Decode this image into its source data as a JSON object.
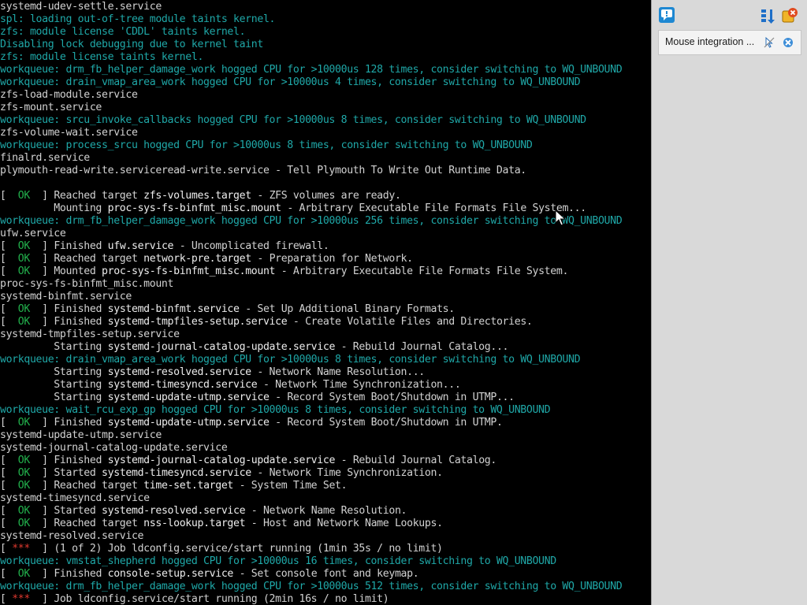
{
  "console": {
    "colors": {
      "default": "#c8c8c8",
      "unit": "#ededed",
      "kernel_message": "#1fa8a8",
      "ok_status": "#22b14c",
      "in_progress_status": "#e0392f",
      "background": "#000000"
    },
    "lines": [
      [
        {
          "t": "systemd-udev-settle.service",
          "c": "white"
        }
      ],
      [
        {
          "t": "spl: loading out-of-tree module taints kernel.",
          "c": "teal"
        }
      ],
      [
        {
          "t": "zfs: module license 'CDDL' taints kernel.",
          "c": "teal"
        }
      ],
      [
        {
          "t": "Disabling lock debugging due to kernel taint",
          "c": "teal"
        }
      ],
      [
        {
          "t": "zfs: module license taints kernel.",
          "c": "teal"
        }
      ],
      [
        {
          "t": "workqueue: drm_fb_helper_damage_work hogged CPU for >10000us 128 times, consider switching to WQ_UNBOUND",
          "c": "teal"
        }
      ],
      [
        {
          "t": "workqueue: drain_vmap_area_work hogged CPU for >10000us 4 times, consider switching to WQ_UNBOUND",
          "c": "teal"
        }
      ],
      [
        {
          "t": "zfs-load-module.service",
          "c": "white"
        }
      ],
      [
        {
          "t": "zfs-mount.service",
          "c": "white"
        }
      ],
      [
        {
          "t": "workqueue: srcu_invoke_callbacks hogged CPU for >10000us 8 times, consider switching to WQ_UNBOUND",
          "c": "teal"
        }
      ],
      [
        {
          "t": "zfs-volume-wait.service",
          "c": "white"
        }
      ],
      [
        {
          "t": "workqueue: process_srcu hogged CPU for >10000us 8 times, consider switching to WQ_UNBOUND",
          "c": "teal"
        }
      ],
      [
        {
          "t": "finalrd.service",
          "c": "white"
        }
      ],
      [
        {
          "t": "plymouth-read-write.serviceread-write.service - Tell Plymouth To Write Out Runtime Data.",
          "c": "white"
        }
      ],
      [
        {
          "t": "",
          "c": "white"
        }
      ],
      [
        {
          "t": "[  ",
          "c": "white"
        },
        {
          "t": "OK",
          "c": "green"
        },
        {
          "t": "  ] Reached target ",
          "c": "white"
        },
        {
          "t": "zfs-volumes.target",
          "c": "highlight"
        },
        {
          "t": " - ZFS volumes are ready.",
          "c": "white"
        }
      ],
      [
        {
          "t": "         Mounting ",
          "c": "white"
        },
        {
          "t": "proc-sys-fs-binfmt_misc.mount",
          "c": "highlight"
        },
        {
          "t": " - Arbitrary Executable File Formats File System...",
          "c": "white"
        }
      ],
      [
        {
          "t": "workqueue: drm_fb_helper_damage_work hogged CPU for >10000us 256 times, consider switching to WQ_UNBOUND",
          "c": "teal"
        }
      ],
      [
        {
          "t": "ufw.service",
          "c": "white"
        }
      ],
      [
        {
          "t": "[  ",
          "c": "white"
        },
        {
          "t": "OK",
          "c": "green"
        },
        {
          "t": "  ] Finished ",
          "c": "white"
        },
        {
          "t": "ufw.service",
          "c": "highlight"
        },
        {
          "t": " - Uncomplicated firewall.",
          "c": "white"
        }
      ],
      [
        {
          "t": "[  ",
          "c": "white"
        },
        {
          "t": "OK",
          "c": "green"
        },
        {
          "t": "  ] Reached target ",
          "c": "white"
        },
        {
          "t": "network-pre.target",
          "c": "highlight"
        },
        {
          "t": " - Preparation for Network.",
          "c": "white"
        }
      ],
      [
        {
          "t": "[  ",
          "c": "white"
        },
        {
          "t": "OK",
          "c": "green"
        },
        {
          "t": "  ] Mounted ",
          "c": "white"
        },
        {
          "t": "proc-sys-fs-binfmt_misc.mount",
          "c": "highlight"
        },
        {
          "t": " - Arbitrary Executable File Formats File System.",
          "c": "white"
        }
      ],
      [
        {
          "t": "proc-sys-fs-binfmt_misc.mount",
          "c": "white"
        }
      ],
      [
        {
          "t": "systemd-binfmt.service",
          "c": "white"
        }
      ],
      [
        {
          "t": "[  ",
          "c": "white"
        },
        {
          "t": "OK",
          "c": "green"
        },
        {
          "t": "  ] Finished ",
          "c": "white"
        },
        {
          "t": "systemd-binfmt.service",
          "c": "highlight"
        },
        {
          "t": " - Set Up Additional Binary Formats.",
          "c": "white"
        }
      ],
      [
        {
          "t": "[  ",
          "c": "white"
        },
        {
          "t": "OK",
          "c": "green"
        },
        {
          "t": "  ] Finished ",
          "c": "white"
        },
        {
          "t": "systemd-tmpfiles-setup.service",
          "c": "highlight"
        },
        {
          "t": " - Create Volatile Files and Directories.",
          "c": "white"
        }
      ],
      [
        {
          "t": "systemd-tmpfiles-setup.service",
          "c": "white"
        }
      ],
      [
        {
          "t": "         Starting ",
          "c": "white"
        },
        {
          "t": "systemd-journal-catalog-update.service",
          "c": "highlight"
        },
        {
          "t": " - Rebuild Journal Catalog...",
          "c": "white"
        }
      ],
      [
        {
          "t": "workqueue: drain_vmap_area_work hogged CPU for >10000us 8 times, consider switching to WQ_UNBOUND",
          "c": "teal"
        }
      ],
      [
        {
          "t": "         Starting ",
          "c": "white"
        },
        {
          "t": "systemd-resolved.service",
          "c": "highlight"
        },
        {
          "t": " - Network Name Resolution...",
          "c": "white"
        }
      ],
      [
        {
          "t": "         Starting ",
          "c": "white"
        },
        {
          "t": "systemd-timesyncd.service",
          "c": "highlight"
        },
        {
          "t": " - Network Time Synchronization...",
          "c": "white"
        }
      ],
      [
        {
          "t": "         Starting ",
          "c": "white"
        },
        {
          "t": "systemd-update-utmp.service",
          "c": "highlight"
        },
        {
          "t": " - Record System Boot/Shutdown in UTMP...",
          "c": "white"
        }
      ],
      [
        {
          "t": "workqueue: wait_rcu_exp_gp hogged CPU for >10000us 8 times, consider switching to WQ_UNBOUND",
          "c": "teal"
        }
      ],
      [
        {
          "t": "[  ",
          "c": "white"
        },
        {
          "t": "OK",
          "c": "green"
        },
        {
          "t": "  ] Finished ",
          "c": "white"
        },
        {
          "t": "systemd-update-utmp.service",
          "c": "highlight"
        },
        {
          "t": " - Record System Boot/Shutdown in UTMP.",
          "c": "white"
        }
      ],
      [
        {
          "t": "systemd-update-utmp.service",
          "c": "white"
        }
      ],
      [
        {
          "t": "systemd-journal-catalog-update.service",
          "c": "white"
        }
      ],
      [
        {
          "t": "[  ",
          "c": "white"
        },
        {
          "t": "OK",
          "c": "green"
        },
        {
          "t": "  ] Finished ",
          "c": "white"
        },
        {
          "t": "systemd-journal-catalog-update.service",
          "c": "highlight"
        },
        {
          "t": " - Rebuild Journal Catalog.",
          "c": "white"
        }
      ],
      [
        {
          "t": "[  ",
          "c": "white"
        },
        {
          "t": "OK",
          "c": "green"
        },
        {
          "t": "  ] Started ",
          "c": "white"
        },
        {
          "t": "systemd-timesyncd.service",
          "c": "highlight"
        },
        {
          "t": " - Network Time Synchronization.",
          "c": "white"
        }
      ],
      [
        {
          "t": "[  ",
          "c": "white"
        },
        {
          "t": "OK",
          "c": "green"
        },
        {
          "t": "  ] Reached target ",
          "c": "white"
        },
        {
          "t": "time-set.target",
          "c": "highlight"
        },
        {
          "t": " - System Time Set.",
          "c": "white"
        }
      ],
      [
        {
          "t": "systemd-timesyncd.service",
          "c": "white"
        }
      ],
      [
        {
          "t": "[  ",
          "c": "white"
        },
        {
          "t": "OK",
          "c": "green"
        },
        {
          "t": "  ] Started ",
          "c": "white"
        },
        {
          "t": "systemd-resolved.service",
          "c": "highlight"
        },
        {
          "t": " - Network Name Resolution.",
          "c": "white"
        }
      ],
      [
        {
          "t": "[  ",
          "c": "white"
        },
        {
          "t": "OK",
          "c": "green"
        },
        {
          "t": "  ] Reached target ",
          "c": "white"
        },
        {
          "t": "nss-lookup.target",
          "c": "highlight"
        },
        {
          "t": " - Host and Network Name Lookups.",
          "c": "white"
        }
      ],
      [
        {
          "t": "systemd-resolved.service",
          "c": "white"
        }
      ],
      [
        {
          "t": "[ ",
          "c": "white"
        },
        {
          "t": "***",
          "c": "red"
        },
        {
          "t": "  ] (1 of 2) Job ldconfig.service/start running (1min 35s / no limit)",
          "c": "white"
        }
      ],
      [
        {
          "t": "workqueue: vmstat_shepherd hogged CPU for >10000us 16 times, consider switching to WQ_UNBOUND",
          "c": "teal"
        }
      ],
      [
        {
          "t": "[  ",
          "c": "white"
        },
        {
          "t": "OK",
          "c": "green"
        },
        {
          "t": "  ] Finished ",
          "c": "white"
        },
        {
          "t": "console-setup.service",
          "c": "highlight"
        },
        {
          "t": " - Set console font and keymap.",
          "c": "white"
        }
      ],
      [
        {
          "t": "workqueue: drm_fb_helper_damage_work hogged CPU for >10000us 512 times, consider switching to WQ_UNBOUND",
          "c": "teal"
        }
      ],
      [
        {
          "t": "[ ",
          "c": "white"
        },
        {
          "t": "***",
          "c": "red"
        },
        {
          "t": "  ] Job ldconfig.service/start running (2min 16s / no limit)",
          "c": "white"
        }
      ]
    ]
  },
  "side_panel": {
    "background": "#d9d9d9",
    "toolbar": {
      "left_icon": "speech-bubble-icon",
      "right_icons": [
        "sort-arrows-icon",
        "close-notifications-icon"
      ]
    },
    "notification": {
      "text": "Mouse integration ...",
      "icons": [
        "mouse-integration-icon",
        "dismiss-icon"
      ]
    }
  },
  "cursor": {
    "icon": "mouse-pointer-icon"
  }
}
